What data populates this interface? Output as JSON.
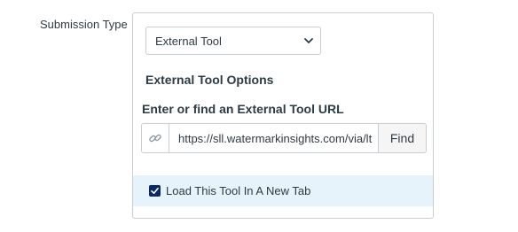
{
  "submission_type": {
    "label": "Submission Type",
    "selected": "External Tool"
  },
  "external_tool": {
    "heading": "External Tool Options",
    "url_label": "Enter or find an External Tool URL",
    "url_value": "https://sll.watermarkinsights.com/via/lt",
    "find_label": "Find",
    "new_tab_label": "Load This Tool In A New Tab",
    "new_tab_checked": true
  },
  "colors": {
    "text": "#2d3b45",
    "border": "#c7cdd1",
    "highlight_row": "#e6f3fb",
    "checkbox": "#0b2a63"
  }
}
